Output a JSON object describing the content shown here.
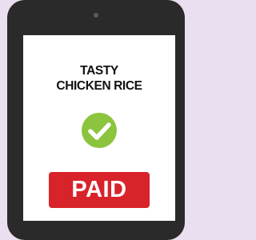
{
  "receipt": {
    "line1": "TASTY",
    "line2": "CHICKEN RICE",
    "status_label": "PAID"
  },
  "icons": {
    "check": "checkmark-circle-icon",
    "speaker": "phone-speaker"
  },
  "colors": {
    "background": "#eadff0",
    "phone_body": "#2a2a2a",
    "screen": "#ffffff",
    "check": "#8cc43d",
    "paid_badge": "#d8232a",
    "text": "#111111"
  }
}
